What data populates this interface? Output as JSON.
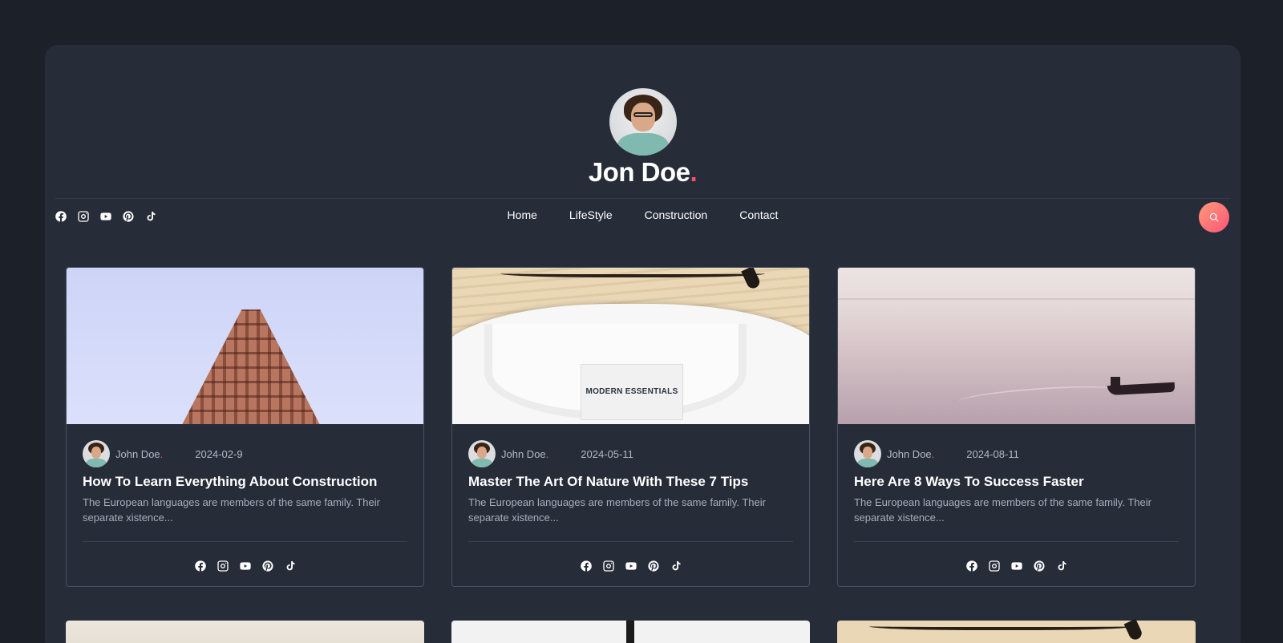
{
  "profile": {
    "name": "Jon Doe",
    "name_dot": "."
  },
  "nav": {
    "items": [
      "Home",
      "LifeStyle",
      "Construction",
      "Contact"
    ]
  },
  "social_icons": [
    "facebook-icon",
    "instagram-icon",
    "youtube-icon",
    "pinterest-icon",
    "tiktok-icon"
  ],
  "colors": {
    "accent": "#ff4d6d",
    "page_bg": "#1b2029",
    "panel_bg": "#262c38"
  },
  "posts": [
    {
      "author": "John Doe",
      "author_dot": ".",
      "date": "2024-02-9",
      "title": "How To Learn Everything About Construction",
      "excerpt": "The European languages are members of the same family. Their separate xistence..."
    },
    {
      "author": "John Doe",
      "author_dot": ".",
      "date": "2024-05-11",
      "title": "Master The Art Of Nature With These 7 Tips",
      "excerpt": "The European languages are members of the same family. Their separate xistence...",
      "image_text": "MODERN ESSENTIALS"
    },
    {
      "author": "John Doe",
      "author_dot": ".",
      "date": "2024-08-11",
      "title": "Here Are 8 Ways To Success Faster",
      "excerpt": "The European languages are members of the same family. Their separate xistence..."
    }
  ]
}
